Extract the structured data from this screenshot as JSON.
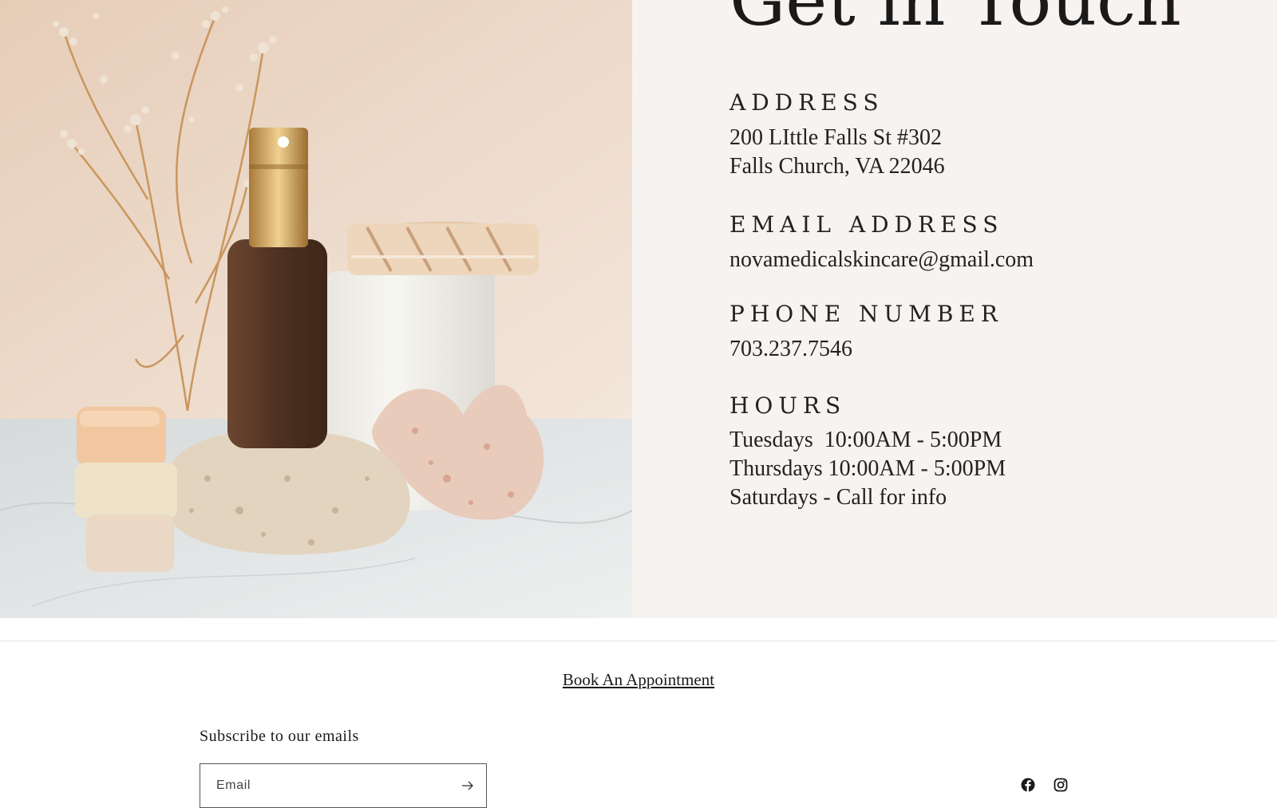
{
  "contact": {
    "title": "Get in Touch",
    "address_label": "ADDRESS",
    "address_line1": "200 LIttle Falls St #302",
    "address_line2": "Falls Church, VA 22046",
    "email_label": "EMAIL ADDRESS",
    "email_value": "novamedicalskincare@gmail.com",
    "phone_label": "PHONE NUMBER",
    "phone_value": "703.237.7546",
    "hours_label": "HOURS",
    "hours": [
      "Tuesdays  10:00AM - 5:00PM",
      "Thursdays 10:00AM - 5:00PM",
      "Saturdays - Call for info"
    ]
  },
  "footer": {
    "book_link": "Book An Appointment",
    "subscribe_title": "Subscribe to our emails",
    "email_placeholder": "Email",
    "socials": [
      "facebook-icon",
      "instagram-icon"
    ]
  },
  "colors": {
    "info_bg": "#f7f3f0",
    "text": "#1a1a1a",
    "photo_wall": "#ecdcd0",
    "photo_marble": "#e4e6e6",
    "bottle": "#5a3a28",
    "cap_gold": "#c8a060"
  }
}
